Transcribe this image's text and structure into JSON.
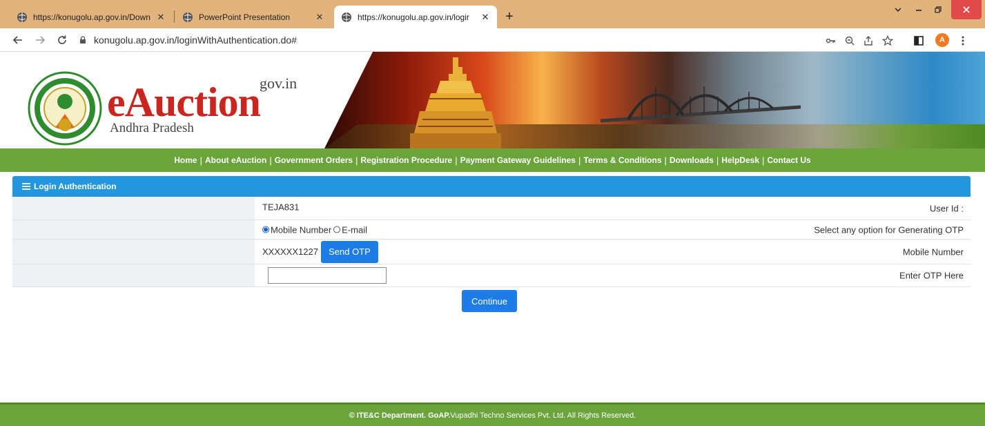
{
  "browser": {
    "tabs": [
      {
        "title": "https://konugolu.ap.gov.in/Down",
        "active": false
      },
      {
        "title": "PowerPoint Presentation",
        "active": false
      },
      {
        "title": "https://konugolu.ap.gov.in/logir",
        "active": true
      }
    ],
    "new_tab": "+",
    "close_glyph": "✕",
    "url": "konugolu.ap.gov.in/loginWithAuthentication.do#",
    "avatar_letter": "A",
    "colors": {
      "tabbar": "#e3b37e",
      "avatar": "#f4791f",
      "close": "#e04a4a"
    }
  },
  "site": {
    "logo": {
      "main": "eAuction",
      "domain": "gov.in",
      "state": "Andhra Pradesh"
    },
    "menu": [
      "Home",
      "About eAuction",
      "Government Orders",
      "Registration Procedure",
      "Payment Gateway Guidelines",
      "Terms & Conditions",
      "Downloads",
      "HelpDesk",
      "Contact Us"
    ],
    "menu_separator": "|",
    "colors": {
      "menu": "#6aa43a",
      "panel_header": "#2496dd",
      "button": "#1e7ce6",
      "logo_red": "#c8261f"
    }
  },
  "login": {
    "header": "Login Authentication",
    "rows": {
      "user_id": {
        "label": "User Id :",
        "value": "TEJA831"
      },
      "otp_option": {
        "label": "Select any option for Generating OTP",
        "options": [
          "Mobile Number",
          "E-mail"
        ],
        "selected": "Mobile Number"
      },
      "mobile": {
        "label": "Mobile Number",
        "value": "XXXXXX1227",
        "button": "Send OTP"
      },
      "otp": {
        "label": "Enter OTP Here",
        "value": ""
      }
    },
    "continue_button": "Continue"
  },
  "footer": {
    "bold_part": "© ITE&C Department. GoAP.",
    "rest": "Vupadhi Techno Services Pvt. Ltd. All Rights Reserved."
  }
}
